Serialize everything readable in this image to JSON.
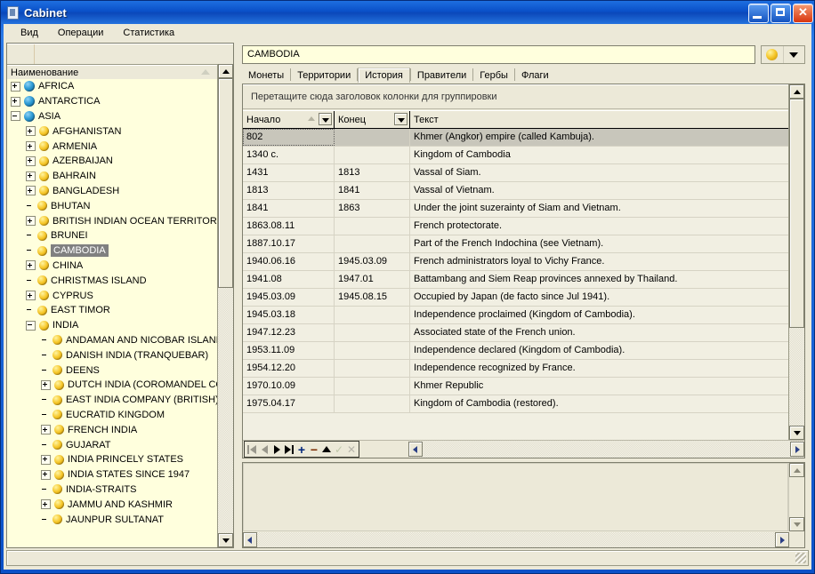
{
  "window": {
    "title": "Cabinet",
    "icon": "cabinet-icon",
    "minimize": "_",
    "maximize": "□",
    "close": "✕"
  },
  "menu": {
    "items": [
      {
        "label": "Вид"
      },
      {
        "label": "Операции"
      },
      {
        "label": "Статистика"
      }
    ]
  },
  "tree": {
    "header": "Наименование",
    "nodes": [
      {
        "label": "AFRICA",
        "indent": 0,
        "expander": "plus",
        "icon": "globe"
      },
      {
        "label": "ANTARCTICA",
        "indent": 0,
        "expander": "plus",
        "icon": "globe"
      },
      {
        "label": "ASIA",
        "indent": 0,
        "expander": "minus",
        "icon": "globe"
      },
      {
        "label": "AFGHANISTAN",
        "indent": 1,
        "expander": "plus",
        "icon": "coin"
      },
      {
        "label": "ARMENIA",
        "indent": 1,
        "expander": "plus",
        "icon": "coin"
      },
      {
        "label": "AZERBAIJAN",
        "indent": 1,
        "expander": "plus",
        "icon": "coin"
      },
      {
        "label": "BAHRAIN",
        "indent": 1,
        "expander": "plus",
        "icon": "coin"
      },
      {
        "label": "BANGLADESH",
        "indent": 1,
        "expander": "plus",
        "icon": "coin"
      },
      {
        "label": "BHUTAN",
        "indent": 1,
        "expander": "none",
        "icon": "coin"
      },
      {
        "label": "BRITISH INDIAN OCEAN TERRITORY",
        "indent": 1,
        "expander": "plus",
        "icon": "coin"
      },
      {
        "label": "BRUNEI",
        "indent": 1,
        "expander": "none",
        "icon": "coin"
      },
      {
        "label": "CAMBODIA",
        "indent": 1,
        "expander": "none",
        "icon": "coin",
        "selected": true
      },
      {
        "label": "CHINA",
        "indent": 1,
        "expander": "plus",
        "icon": "coin"
      },
      {
        "label": "CHRISTMAS ISLAND",
        "indent": 1,
        "expander": "none",
        "icon": "coin"
      },
      {
        "label": "CYPRUS",
        "indent": 1,
        "expander": "plus",
        "icon": "coin"
      },
      {
        "label": "EAST TIMOR",
        "indent": 1,
        "expander": "none",
        "icon": "coin"
      },
      {
        "label": "INDIA",
        "indent": 1,
        "expander": "minus",
        "icon": "coin"
      },
      {
        "label": "ANDAMAN AND NICOBAR ISLANDS",
        "indent": 2,
        "expander": "none",
        "icon": "coin"
      },
      {
        "label": "DANISH INDIA  (TRANQUEBAR)",
        "indent": 2,
        "expander": "none",
        "icon": "coin"
      },
      {
        "label": "DEENS",
        "indent": 2,
        "expander": "none",
        "icon": "coin"
      },
      {
        "label": "DUTCH INDIA (COROMANDEL COAST",
        "indent": 2,
        "expander": "plus",
        "icon": "coin"
      },
      {
        "label": "EAST INDIA COMPANY (BRITISH)",
        "indent": 2,
        "expander": "none",
        "icon": "coin"
      },
      {
        "label": "EUCRATID KINGDOM",
        "indent": 2,
        "expander": "none",
        "icon": "coin"
      },
      {
        "label": "FRENCH INDIA",
        "indent": 2,
        "expander": "plus",
        "icon": "coin"
      },
      {
        "label": "GUJARAT",
        "indent": 2,
        "expander": "none",
        "icon": "coin"
      },
      {
        "label": "INDIA PRINCELY STATES",
        "indent": 2,
        "expander": "plus",
        "icon": "coin"
      },
      {
        "label": "INDIA STATES SINCE 1947",
        "indent": 2,
        "expander": "plus",
        "icon": "coin"
      },
      {
        "label": "INDIA-STRAITS",
        "indent": 2,
        "expander": "none",
        "icon": "coin"
      },
      {
        "label": "JAMMU AND KASHMIR",
        "indent": 2,
        "expander": "plus",
        "icon": "coin"
      },
      {
        "label": "JAUNPUR SULTANAT",
        "indent": 2,
        "expander": "none",
        "icon": "coin"
      }
    ]
  },
  "detail": {
    "title_value": "CAMBODIA",
    "coin_dropdown_icon": "coin-icon",
    "tabs": [
      {
        "label": "Монеты",
        "active": false
      },
      {
        "label": "Территории",
        "active": false
      },
      {
        "label": "История",
        "active": true
      },
      {
        "label": "Правители",
        "active": false
      },
      {
        "label": "Гербы",
        "active": false
      },
      {
        "label": "Флаги",
        "active": false
      }
    ],
    "group_panel_hint": "Перетащите сюда заголовок колонки для группировки",
    "columns": [
      "Начало",
      "Конец",
      "Текст"
    ],
    "rows": [
      {
        "start": "802",
        "end": "",
        "text": "Khmer (Angkor) empire (called Kambuja).",
        "selected": true
      },
      {
        "start": "1340 c.",
        "end": "",
        "text": "Kingdom of Cambodia"
      },
      {
        "start": "1431",
        "end": "1813",
        "text": "Vassal of Siam."
      },
      {
        "start": "1813",
        "end": "1841",
        "text": "Vassal of Vietnam."
      },
      {
        "start": "1841",
        "end": "1863",
        "text": "Under the joint suzerainty of Siam and Vietnam."
      },
      {
        "start": "1863.08.11",
        "end": "",
        "text": "French protectorate."
      },
      {
        "start": "1887.10.17",
        "end": "",
        "text": "Part of the French Indochina (see Vietnam)."
      },
      {
        "start": "1940.06.16",
        "end": "1945.03.09",
        "text": "French administrators loyal to Vichy France."
      },
      {
        "start": "1941.08",
        "end": "1947.01",
        "text": "Battambang and Siem Reap provinces annexed by Thailand."
      },
      {
        "start": "1945.03.09",
        "end": "1945.08.15",
        "text": "Occupied by Japan (de facto since Jul 1941)."
      },
      {
        "start": "1945.03.18",
        "end": "",
        "text": "Independence proclaimed (Kingdom of Cambodia)."
      },
      {
        "start": "1947.12.23",
        "end": "",
        "text": "Associated state of the French union."
      },
      {
        "start": "1953.11.09",
        "end": "",
        "text": "Independence declared (Kingdom of Cambodia)."
      },
      {
        "start": "1954.12.20",
        "end": "",
        "text": "Independence recognized by France."
      },
      {
        "start": "1970.10.09",
        "end": "",
        "text": "Khmer Republic"
      },
      {
        "start": "1975.04.17",
        "end": "",
        "text": "Kingdom of Cambodia (restored)."
      }
    ],
    "navigator": {
      "first": "first-record",
      "prior": "prior-record",
      "next": "next-record",
      "last": "last-record",
      "insert": "+",
      "delete": "−",
      "edit": "edit-record",
      "post": "✓",
      "cancel": "✕"
    }
  },
  "memo": {
    "value": ""
  },
  "status": {
    "text": ""
  },
  "colors": {
    "titlebar": "#0a50c8",
    "tree_bg": "#ffffdd",
    "panel_bg": "#ece9d8",
    "grid_bg": "#f1efe2",
    "selection": "#808080",
    "row_selection": "#c8c6bb",
    "close_button": "#d8360f"
  }
}
